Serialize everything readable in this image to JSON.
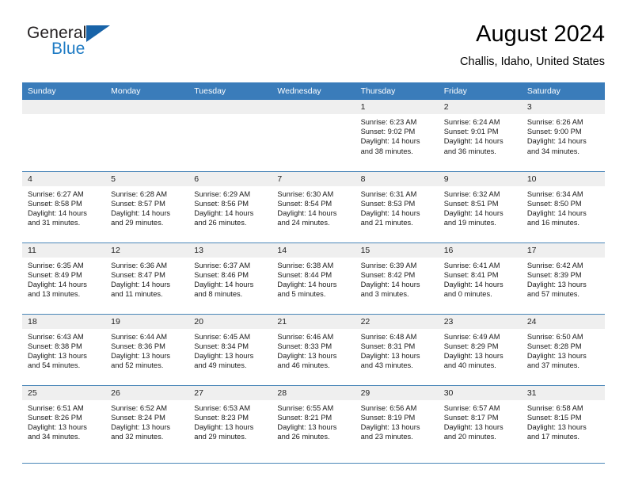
{
  "brand": {
    "name_top": "General",
    "name_bottom": "Blue",
    "accent_color": "#1e7bc4",
    "flag_color": "#1863a8"
  },
  "header": {
    "title": "August 2024",
    "location": "Challis, Idaho, United States"
  },
  "theme": {
    "header_bg": "#3a7cba",
    "header_text": "#ffffff",
    "daynum_bg": "#efefef",
    "rule_color": "#4a86b8"
  },
  "weekdays": [
    "Sunday",
    "Monday",
    "Tuesday",
    "Wednesday",
    "Thursday",
    "Friday",
    "Saturday"
  ],
  "weeks": [
    [
      {
        "day": "",
        "empty": true
      },
      {
        "day": "",
        "empty": true
      },
      {
        "day": "",
        "empty": true
      },
      {
        "day": "",
        "empty": true
      },
      {
        "day": "1",
        "sunrise": "Sunrise: 6:23 AM",
        "sunset": "Sunset: 9:02 PM",
        "daylight": "Daylight: 14 hours and 38 minutes."
      },
      {
        "day": "2",
        "sunrise": "Sunrise: 6:24 AM",
        "sunset": "Sunset: 9:01 PM",
        "daylight": "Daylight: 14 hours and 36 minutes."
      },
      {
        "day": "3",
        "sunrise": "Sunrise: 6:26 AM",
        "sunset": "Sunset: 9:00 PM",
        "daylight": "Daylight: 14 hours and 34 minutes."
      }
    ],
    [
      {
        "day": "4",
        "sunrise": "Sunrise: 6:27 AM",
        "sunset": "Sunset: 8:58 PM",
        "daylight": "Daylight: 14 hours and 31 minutes."
      },
      {
        "day": "5",
        "sunrise": "Sunrise: 6:28 AM",
        "sunset": "Sunset: 8:57 PM",
        "daylight": "Daylight: 14 hours and 29 minutes."
      },
      {
        "day": "6",
        "sunrise": "Sunrise: 6:29 AM",
        "sunset": "Sunset: 8:56 PM",
        "daylight": "Daylight: 14 hours and 26 minutes."
      },
      {
        "day": "7",
        "sunrise": "Sunrise: 6:30 AM",
        "sunset": "Sunset: 8:54 PM",
        "daylight": "Daylight: 14 hours and 24 minutes."
      },
      {
        "day": "8",
        "sunrise": "Sunrise: 6:31 AM",
        "sunset": "Sunset: 8:53 PM",
        "daylight": "Daylight: 14 hours and 21 minutes."
      },
      {
        "day": "9",
        "sunrise": "Sunrise: 6:32 AM",
        "sunset": "Sunset: 8:51 PM",
        "daylight": "Daylight: 14 hours and 19 minutes."
      },
      {
        "day": "10",
        "sunrise": "Sunrise: 6:34 AM",
        "sunset": "Sunset: 8:50 PM",
        "daylight": "Daylight: 14 hours and 16 minutes."
      }
    ],
    [
      {
        "day": "11",
        "sunrise": "Sunrise: 6:35 AM",
        "sunset": "Sunset: 8:49 PM",
        "daylight": "Daylight: 14 hours and 13 minutes."
      },
      {
        "day": "12",
        "sunrise": "Sunrise: 6:36 AM",
        "sunset": "Sunset: 8:47 PM",
        "daylight": "Daylight: 14 hours and 11 minutes."
      },
      {
        "day": "13",
        "sunrise": "Sunrise: 6:37 AM",
        "sunset": "Sunset: 8:46 PM",
        "daylight": "Daylight: 14 hours and 8 minutes."
      },
      {
        "day": "14",
        "sunrise": "Sunrise: 6:38 AM",
        "sunset": "Sunset: 8:44 PM",
        "daylight": "Daylight: 14 hours and 5 minutes."
      },
      {
        "day": "15",
        "sunrise": "Sunrise: 6:39 AM",
        "sunset": "Sunset: 8:42 PM",
        "daylight": "Daylight: 14 hours and 3 minutes."
      },
      {
        "day": "16",
        "sunrise": "Sunrise: 6:41 AM",
        "sunset": "Sunset: 8:41 PM",
        "daylight": "Daylight: 14 hours and 0 minutes."
      },
      {
        "day": "17",
        "sunrise": "Sunrise: 6:42 AM",
        "sunset": "Sunset: 8:39 PM",
        "daylight": "Daylight: 13 hours and 57 minutes."
      }
    ],
    [
      {
        "day": "18",
        "sunrise": "Sunrise: 6:43 AM",
        "sunset": "Sunset: 8:38 PM",
        "daylight": "Daylight: 13 hours and 54 minutes."
      },
      {
        "day": "19",
        "sunrise": "Sunrise: 6:44 AM",
        "sunset": "Sunset: 8:36 PM",
        "daylight": "Daylight: 13 hours and 52 minutes."
      },
      {
        "day": "20",
        "sunrise": "Sunrise: 6:45 AM",
        "sunset": "Sunset: 8:34 PM",
        "daylight": "Daylight: 13 hours and 49 minutes."
      },
      {
        "day": "21",
        "sunrise": "Sunrise: 6:46 AM",
        "sunset": "Sunset: 8:33 PM",
        "daylight": "Daylight: 13 hours and 46 minutes."
      },
      {
        "day": "22",
        "sunrise": "Sunrise: 6:48 AM",
        "sunset": "Sunset: 8:31 PM",
        "daylight": "Daylight: 13 hours and 43 minutes."
      },
      {
        "day": "23",
        "sunrise": "Sunrise: 6:49 AM",
        "sunset": "Sunset: 8:29 PM",
        "daylight": "Daylight: 13 hours and 40 minutes."
      },
      {
        "day": "24",
        "sunrise": "Sunrise: 6:50 AM",
        "sunset": "Sunset: 8:28 PM",
        "daylight": "Daylight: 13 hours and 37 minutes."
      }
    ],
    [
      {
        "day": "25",
        "sunrise": "Sunrise: 6:51 AM",
        "sunset": "Sunset: 8:26 PM",
        "daylight": "Daylight: 13 hours and 34 minutes."
      },
      {
        "day": "26",
        "sunrise": "Sunrise: 6:52 AM",
        "sunset": "Sunset: 8:24 PM",
        "daylight": "Daylight: 13 hours and 32 minutes."
      },
      {
        "day": "27",
        "sunrise": "Sunrise: 6:53 AM",
        "sunset": "Sunset: 8:23 PM",
        "daylight": "Daylight: 13 hours and 29 minutes."
      },
      {
        "day": "28",
        "sunrise": "Sunrise: 6:55 AM",
        "sunset": "Sunset: 8:21 PM",
        "daylight": "Daylight: 13 hours and 26 minutes."
      },
      {
        "day": "29",
        "sunrise": "Sunrise: 6:56 AM",
        "sunset": "Sunset: 8:19 PM",
        "daylight": "Daylight: 13 hours and 23 minutes."
      },
      {
        "day": "30",
        "sunrise": "Sunrise: 6:57 AM",
        "sunset": "Sunset: 8:17 PM",
        "daylight": "Daylight: 13 hours and 20 minutes."
      },
      {
        "day": "31",
        "sunrise": "Sunrise: 6:58 AM",
        "sunset": "Sunset: 8:15 PM",
        "daylight": "Daylight: 13 hours and 17 minutes."
      }
    ]
  ]
}
